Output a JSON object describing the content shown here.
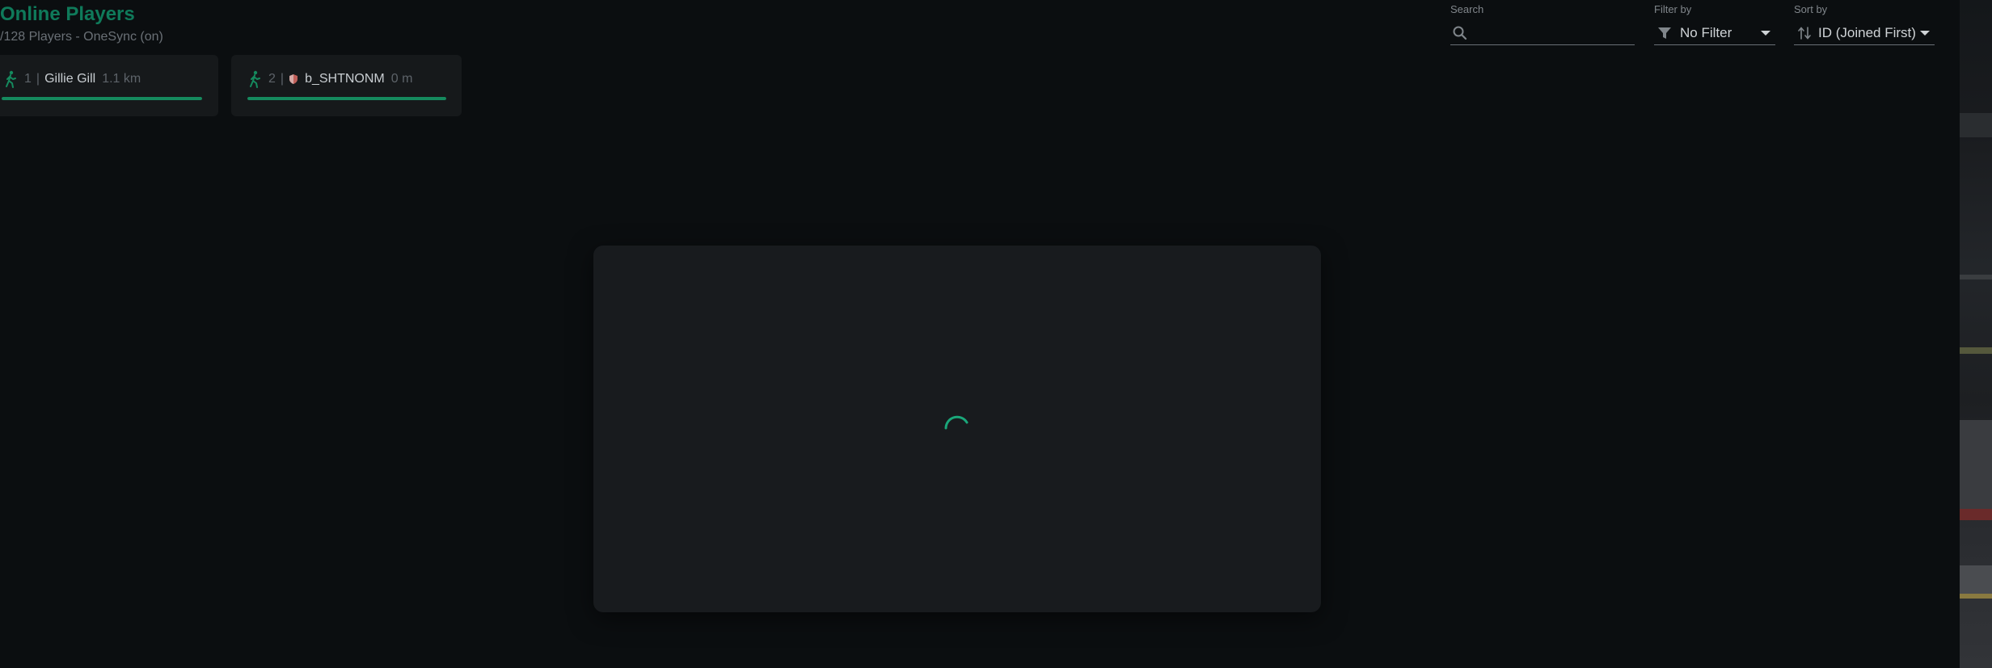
{
  "header": {
    "title": "Online Players",
    "subtitle": "/128 Players - OneSync (on)"
  },
  "players": [
    {
      "id": "1",
      "name": "Gillie Gill",
      "distance": "1.1 km",
      "icon": "walking-person-icon",
      "health": 1.0,
      "is_admin": false
    },
    {
      "id": "2",
      "name": "b_SHTNONM",
      "distance": "0 m",
      "icon": "walking-person-icon",
      "health": 1.0,
      "is_admin": true,
      "badge_icon": "shield-icon"
    }
  ],
  "search": {
    "label": "Search",
    "value": "",
    "icon": "search-icon"
  },
  "filter": {
    "label": "Filter by",
    "value": "No Filter",
    "icon": "filter-icon"
  },
  "sort": {
    "label": "Sort by",
    "value": "ID (Joined First)",
    "icon": "sort-icon"
  },
  "colors": {
    "accent": "#0f7a5a",
    "health": "#158a5e",
    "background": "#0b0e10",
    "card": "#16191b",
    "modal": "#181b1e",
    "spinner": "#1aa77a",
    "admin_shield": "#c0605a"
  },
  "modal": {
    "state": "loading"
  }
}
